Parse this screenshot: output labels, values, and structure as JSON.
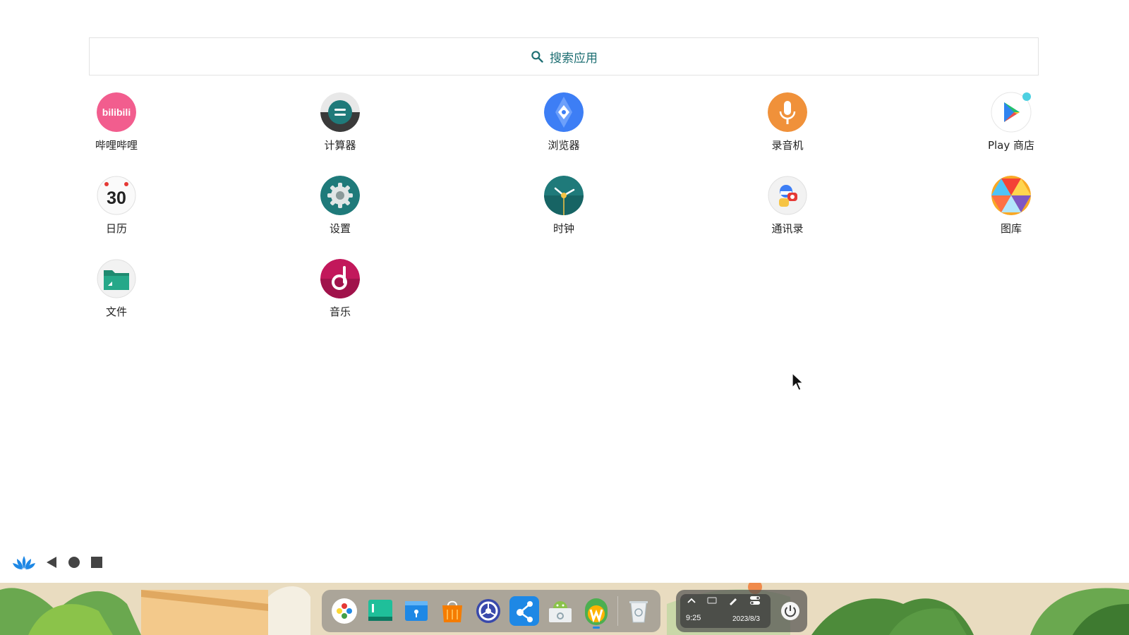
{
  "search": {
    "placeholder": "搜索应用"
  },
  "apps": [
    {
      "label": "哔哩哔哩",
      "icon": "bilibili-icon"
    },
    {
      "label": "计算器",
      "icon": "calculator-icon"
    },
    {
      "label": "浏览器",
      "icon": "browser-icon"
    },
    {
      "label": "录音机",
      "icon": "recorder-icon"
    },
    {
      "label": "Play 商店",
      "icon": "play-store-icon"
    },
    {
      "label": "日历",
      "icon": "calendar-icon",
      "day": "30"
    },
    {
      "label": "设置",
      "icon": "settings-icon"
    },
    {
      "label": "时钟",
      "icon": "clock-icon"
    },
    {
      "label": "通讯录",
      "icon": "contacts-icon"
    },
    {
      "label": "图库",
      "icon": "gallery-icon"
    },
    {
      "label": "文件",
      "icon": "files-icon"
    },
    {
      "label": "音乐",
      "icon": "music-icon"
    }
  ],
  "bilibili_text": "bilibili",
  "navbar": [
    "lotus-launcher-icon",
    "back-icon",
    "home-icon",
    "recents-icon"
  ],
  "dock": [
    "launcher-icon",
    "terminal-icon",
    "file-manager-icon",
    "app-store-icon",
    "system-settings-icon",
    "connect-icon",
    "android-icon",
    "waydroid-icon",
    "trash-icon"
  ],
  "tray": {
    "time": "9:25",
    "date": "2023/8/3"
  },
  "colors": {
    "accent": "#1e6f73",
    "bilibili": "#f25d8e",
    "browser": "#3d7ef5",
    "recorder": "#f0913a"
  }
}
